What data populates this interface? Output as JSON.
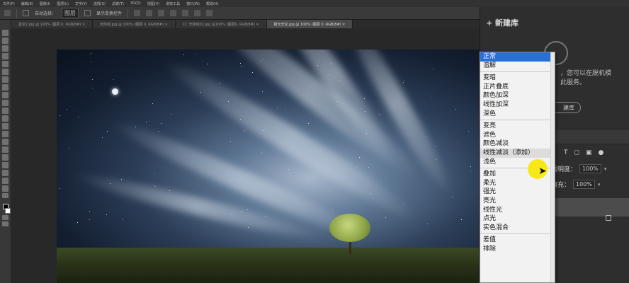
{
  "menu_bar": [
    "文件(F)",
    "编辑(E)",
    "图像(I)",
    "图层(L)",
    "文字(Y)",
    "选择(S)",
    "滤镜(T)",
    "3D(D)",
    "视图(V)",
    "增效工具",
    "窗口(W)",
    "帮助(H)"
  ],
  "options_bar": {
    "auto_select_label": "自动选择：",
    "auto_select_value": "图层",
    "transform_label": "显示变换控件"
  },
  "tabs": [
    {
      "label": "星空2.jpg @ 100% (图层 0, RGB/8#)",
      "active": false
    },
    {
      "label": "天际线.jpg @ 100% (图层 0, RGB/8#)",
      "active": false
    },
    {
      "label": "CC 天际线02.jpg @100% (图层0, RGB/8#)",
      "active": false
    },
    {
      "label": "极光天空.jpg @ 100% (图层 0, RGB/8#)",
      "active": true
    }
  ],
  "library_panel": {
    "new_library_label": "+ 新建库",
    "info_text_line1": "，您可以在脱机模",
    "info_text_line2": "此服务。",
    "create_button_label": "建库"
  },
  "layers_panel": {
    "opacity_label": "透明度：",
    "opacity_value": "100%",
    "fill_label": "填充：",
    "fill_value": "100%"
  },
  "blend_menu": {
    "groups": [
      [
        "正常",
        "溶解"
      ],
      [
        "变暗",
        "正片叠底",
        "颜色加深",
        "线性加深",
        "深色"
      ],
      [
        "变亮",
        "滤色",
        "颜色减淡",
        "线性减淡（添加）",
        "浅色"
      ],
      [
        "叠加",
        "柔光",
        "强光",
        "亮光",
        "线性光",
        "点光",
        "实色混合"
      ],
      [
        "差值",
        "排除"
      ]
    ],
    "selected": "正常",
    "hovered": "线性减淡（添加）"
  }
}
